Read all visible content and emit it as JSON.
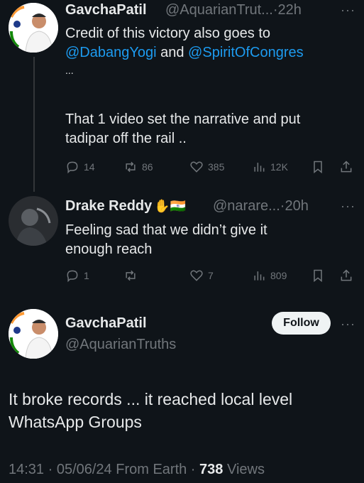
{
  "tweet1": {
    "name": "GavchaPatil",
    "handle": "@AquarianTrut...",
    "sep": "·",
    "time": "22h",
    "line1": "Credit of this victory also goes to",
    "mention1": "@DabangYogi",
    "and": " and ",
    "mention2": "@SpiritOfCongres",
    "ellipsis": "...",
    "line3": "That 1 video set the narrative and put",
    "line4": "tadipar off the rail ..",
    "replies": "14",
    "reposts": "86",
    "likes": "385",
    "views": "12K"
  },
  "tweet2": {
    "name": "Drake Reddy",
    "emoji": "✋🇮🇳",
    "handle": "@narare...",
    "sep": "·",
    "time": "20h",
    "line1": "Feeling sad that we didn’t give it",
    "line2": "enough reach",
    "replies": "1",
    "reposts": "",
    "likes": "7",
    "views": "809"
  },
  "main": {
    "name": "GavchaPatil",
    "handle": "@AquarianTruths",
    "follow_label": "Follow",
    "line1": "It broke records ... it reached local level",
    "line2": "WhatsApp Groups",
    "time": "14:31 · 05/06/24 From Earth · ",
    "views_count": "738",
    "views_label": " Views"
  },
  "colors": {
    "background": "#0f1419",
    "text": "#e7e9ea",
    "muted": "#71767b",
    "link": "#1d9bf0"
  }
}
